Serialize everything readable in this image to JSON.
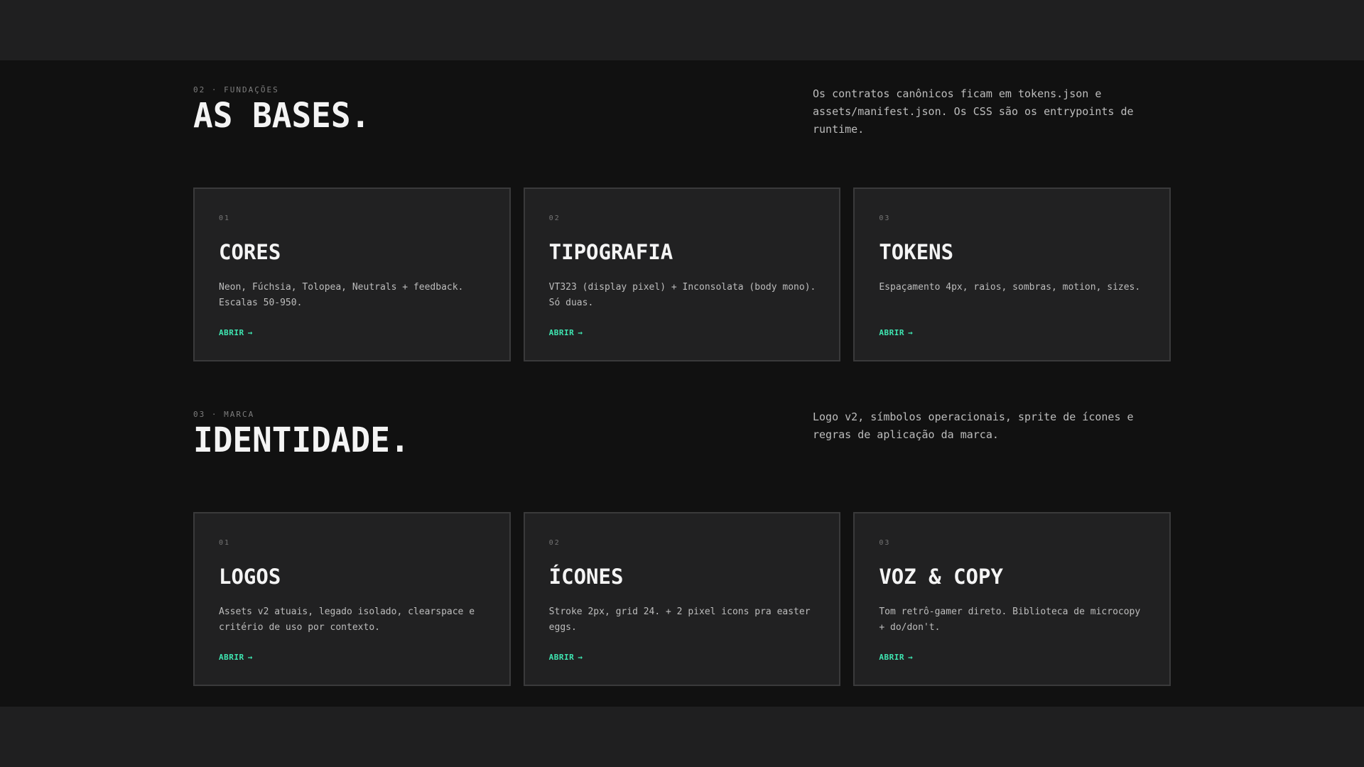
{
  "sections": [
    {
      "eyebrow": "02 · FUNDAÇÕES",
      "title": "AS BASES.",
      "description": "Os contratos canônicos ficam em tokens.json e assets/manifest.json. Os CSS são os entrypoints de runtime.",
      "cards": [
        {
          "num": "01",
          "title": "CORES",
          "desc": "Neon, Fúchsia, Tolopea, Neutrals + feedback. Escalas 50-950.",
          "link": "ABRIR",
          "arrow": "→"
        },
        {
          "num": "02",
          "title": "TIPOGRAFIA",
          "desc": "VT323 (display pixel) + Inconsolata (body mono). Só duas.",
          "link": "ABRIR",
          "arrow": "→"
        },
        {
          "num": "03",
          "title": "TOKENS",
          "desc": "Espaçamento 4px, raios, sombras, motion, sizes.",
          "link": "ABRIR",
          "arrow": "→"
        }
      ]
    },
    {
      "eyebrow": "03 · MARCA",
      "title": "IDENTIDADE.",
      "description": "Logo v2, símbolos operacionais, sprite de ícones e regras de aplicação da marca.",
      "cards": [
        {
          "num": "01",
          "title": "LOGOS",
          "desc": "Assets v2 atuais, legado isolado, clearspace e critério de uso por contexto.",
          "link": "ABRIR",
          "arrow": "→"
        },
        {
          "num": "02",
          "title": "ÍCONES",
          "desc": "Stroke 2px, grid 24. + 2 pixel icons pra easter eggs.",
          "link": "ABRIR",
          "arrow": "→"
        },
        {
          "num": "03",
          "title": "VOZ & COPY",
          "desc": "Tom retrô-gamer direto. Biblioteca de microcopy + do/don't.",
          "link": "ABRIR",
          "arrow": "→"
        }
      ]
    }
  ],
  "colors": {
    "accent": "#3fe6b2",
    "background": "#111111",
    "card": "#212122",
    "band": "#1f1f20"
  }
}
